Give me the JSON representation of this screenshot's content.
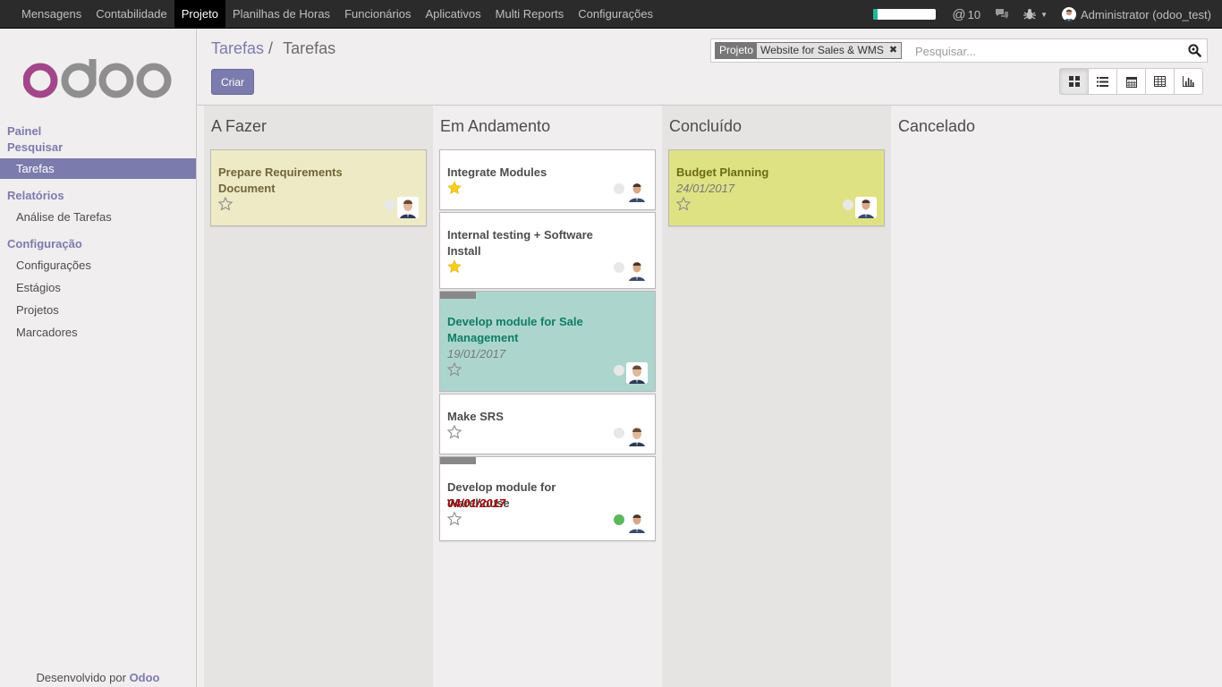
{
  "topmenu": {
    "items": [
      {
        "label": "Mensagens",
        "active": false
      },
      {
        "label": "Contabilidade",
        "active": false
      },
      {
        "label": "Projeto",
        "active": true
      },
      {
        "label": "Planilhas de Horas",
        "active": false
      },
      {
        "label": "Funcionários",
        "active": false
      },
      {
        "label": "Aplicativos",
        "active": false
      },
      {
        "label": "Multi Reports",
        "active": false
      },
      {
        "label": "Configurações",
        "active": false
      }
    ],
    "mentions_count": "10",
    "user_name": "Administrator (odoo_test)",
    "progress_fraction": 0.07
  },
  "sidebar": {
    "powered_by_prefix": "Desenvolvido por",
    "powered_by_brand": "Odoo",
    "sections": [
      {
        "title": "Painel"
      },
      {
        "title": "Pesquisar"
      },
      {
        "title": "Relatórios"
      },
      {
        "title": "Configuração"
      }
    ],
    "items": [
      {
        "label": "Tarefas",
        "active": true
      },
      {
        "label": "Análise de Tarefas",
        "active": false
      },
      {
        "label": "Configurações",
        "active": false
      },
      {
        "label": "Estágios",
        "active": false
      },
      {
        "label": "Projetos",
        "active": false
      },
      {
        "label": "Marcadores",
        "active": false
      }
    ]
  },
  "control": {
    "breadcrumb_parent": "Tarefas",
    "breadcrumb_separator": "/",
    "breadcrumb_current": "Tarefas",
    "create_label": "Criar",
    "search": {
      "facet_label": "Projeto",
      "facet_value": "Website for Sales & WMS",
      "placeholder": "Pesquisar..."
    },
    "views": [
      "kanban-icon",
      "list-icon",
      "calendar-icon",
      "pivot-icon",
      "graph-icon"
    ],
    "active_view": "kanban-icon"
  },
  "kanban": {
    "columns": [
      {
        "title": "A Fazer",
        "cards": [
          {
            "title": "Prepare Requirements Document",
            "date": "",
            "starred": false,
            "state": "normal",
            "color": "#eeeac6",
            "title_color": "#706637"
          }
        ]
      },
      {
        "title": "Em Andamento",
        "cards": [
          {
            "title": "Integrate Modules",
            "date": "",
            "starred": true,
            "state": "normal",
            "color": "#ffffff"
          },
          {
            "title": "Internal testing + Software Install",
            "date": "",
            "starred": true,
            "state": "normal",
            "color": "#ffffff"
          },
          {
            "title": "Develop module for Sale Management",
            "date": "19/01/2017",
            "starred": false,
            "state": "normal",
            "color": "#acd6cd",
            "title_color": "#107c63",
            "tag": true
          },
          {
            "title": "Make SRS",
            "date": "",
            "starred": false,
            "state": "normal",
            "color": "#ffffff"
          },
          {
            "title": "Develop module for Warehouse",
            "date": "04/01/2017",
            "date_overdue": true,
            "starred": false,
            "state": "done",
            "color": "#ffffff",
            "tag": true
          }
        ]
      },
      {
        "title": "Concluído",
        "cards": [
          {
            "title": "Budget Planning",
            "date": "24/01/2017",
            "starred": false,
            "state": "normal",
            "color": "#dfe283",
            "title_color": "#6d6a17"
          }
        ]
      },
      {
        "title": "Cancelado",
        "cards": []
      }
    ]
  },
  "colors": {
    "brand": "#7c7bad",
    "star": "#f7cd1f",
    "state_done": "#5cb85c"
  }
}
